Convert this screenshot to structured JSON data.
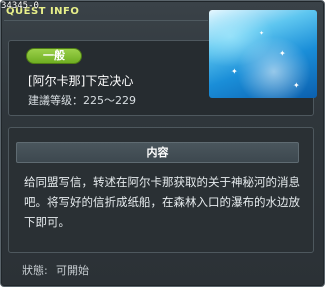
{
  "quest": {
    "code": "34345-0",
    "window_title": "QUEST INFO",
    "category_badge": "一般",
    "name": "[阿尔卡那]下定决心",
    "level": "建議等级：225～229",
    "section_title": "内容",
    "description": "给同盟写信，转述在阿尔卡那获取的关于神秘河的消息吧。将写好的信折成纸船，在森林入口的瀑布的水边放下即可。",
    "status_label": "狀態:",
    "status_value": "可開始"
  },
  "colors": {
    "title": "#e8f08a",
    "badge": "#7dbd2e",
    "panel": "#2a3034",
    "window": "#33393e"
  },
  "image": {
    "icon": "sparkling-water-illustration"
  }
}
